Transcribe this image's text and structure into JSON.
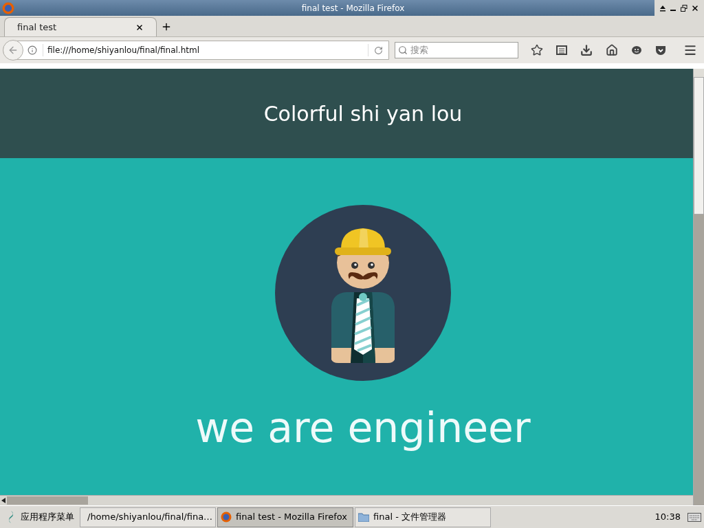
{
  "window": {
    "title": "final test - Mozilla Firefox"
  },
  "tabs": [
    {
      "label": "final test",
      "selected": true
    }
  ],
  "address_bar": {
    "value": "file:///home/shiyanlou/final/final.html"
  },
  "search": {
    "placeholder": "搜索"
  },
  "page": {
    "header": "Colorful shi yan lou",
    "headline": "we are engineer"
  },
  "taskbar": {
    "menu": "应用程序菜单",
    "tasks": [
      {
        "label": "/home/shiyanlou/final/fina…",
        "kind": "window",
        "selected": false
      },
      {
        "label": "final test - Mozilla Firefox",
        "kind": "firefox",
        "selected": true
      },
      {
        "label": "final - 文件管理器",
        "kind": "folder",
        "selected": false
      }
    ],
    "clock": "10:38"
  }
}
